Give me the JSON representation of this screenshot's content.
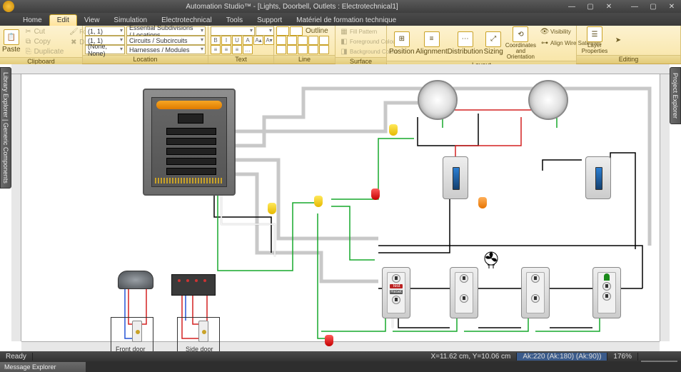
{
  "app": {
    "title": "Automation Studio™ - [Lights, Doorbell, Outlets : Electrotechnical1]"
  },
  "window": {
    "min": "—",
    "max": "▢",
    "close": "✕",
    "child_min": "—",
    "child_max": "▢",
    "child_close": "✕"
  },
  "tabs": {
    "home": "Home",
    "edit": "Edit",
    "view": "View",
    "simulation": "Simulation",
    "electrotechnical": "Electrotechnical",
    "tools": "Tools",
    "support": "Support",
    "training": "Matériel de formation technique"
  },
  "ribbon": {
    "clipboard": {
      "label": "Clipboard",
      "paste": "Paste",
      "cut": "Cut",
      "copy": "Copy",
      "format_painter": "Format Painter",
      "delete": "Delete",
      "duplicate": "Duplicate"
    },
    "location": {
      "label": "Location",
      "coord1": "(1, 1)",
      "coord2": "(1, 1)",
      "coord3": "(None, None)",
      "opt1": "Essential Subdivisions / Locations",
      "opt2": "Circuits / Subcircuits",
      "opt3": "Harnesses / Modules"
    },
    "text": {
      "label": "Text",
      "font": "",
      "size": ""
    },
    "line": {
      "label": "Line",
      "outline": "Outline"
    },
    "surface": {
      "label": "Surface",
      "fill": "Fill Pattern",
      "fg": "Foreground Colour",
      "bg": "Background Colour"
    },
    "layout": {
      "label": "Layout",
      "position": "Position",
      "alignment": "Alignment",
      "distribution": "Distribution",
      "sizing": "Sizing",
      "coords": "Coordinates and Orientation",
      "visibility": "Visibility",
      "align_wire": "Align Wire Satellites"
    },
    "editing": {
      "label": "Editing",
      "layer": "Layer Properties"
    }
  },
  "side": {
    "left": "Library Explorer | Generic Components",
    "right": "Project Explorer"
  },
  "diagram": {
    "front_door": "Front door",
    "side_door": "Side door",
    "gfci_test": "Test",
    "gfci_reset": "Reset"
  },
  "status": {
    "ready": "Ready",
    "coords": "X=11.62 cm, Y=10.06 cm",
    "grid": "Ak:220 (Ak:180) (Ak:90))",
    "zoom": "176%",
    "msg": "Message Explorer"
  }
}
